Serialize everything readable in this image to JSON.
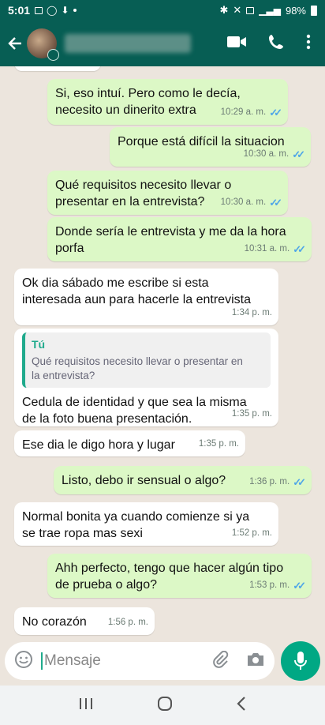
{
  "status_bar": {
    "time": "5:01",
    "battery": "98%"
  },
  "header": {
    "contact_name": ""
  },
  "messages": [
    {
      "text": "Si, eso intuí. Pero como le decía,\nnecesito un dinerito extra",
      "time": "10:29 a. m."
    },
    {
      "text": "Porque está difícil la situacion",
      "time": "10:30 a. m."
    },
    {
      "text": "Qué requisitos necesito llevar o\npresentar en la entrevista?",
      "time": "10:30 a. m."
    },
    {
      "text": "Donde sería le entrevista y me da la hora\nporfa",
      "time": "10:31 a. m."
    },
    {
      "text": "Ok dia sábado me escribe si esta\ninteresada aun para hacerle la entrevista",
      "time": "1:34 p. m."
    },
    {
      "quote_author": "Tú",
      "quote_text": "Qué requisitos necesito llevar o presentar en\nla entrevista?",
      "text": "Cedula de identidad y que sea la misma\nde la foto buena presentación.",
      "time": "1:35 p. m."
    },
    {
      "text": "Ese dia le digo hora y lugar",
      "time": "1:35 p. m."
    },
    {
      "text": "Listo, debo ir sensual o algo?",
      "time": "1:36 p. m."
    },
    {
      "text": "Normal bonita ya cuando comienze si ya\nse trae ropa mas sexi",
      "time": "1:52 p. m."
    },
    {
      "text": "Ahh perfecto, tengo que hacer algún tipo\nde prueba o algo?",
      "time": "1:53 p. m."
    },
    {
      "text": "No corazón",
      "time": "1:56 p. m."
    }
  ],
  "input": {
    "placeholder": "Mensaje"
  },
  "colors": {
    "header": "#075e54",
    "outgoing": "#dcf8c6",
    "incoming": "#ffffff",
    "accent": "#00a884",
    "ticks": "#4fa6e8"
  },
  "icons": [
    "back-arrow-icon",
    "video-call-icon",
    "phone-icon",
    "more-options-icon",
    "emoji-icon",
    "attach-icon",
    "camera-icon",
    "mic-icon",
    "recents-icon",
    "home-icon",
    "back-nav-icon"
  ]
}
